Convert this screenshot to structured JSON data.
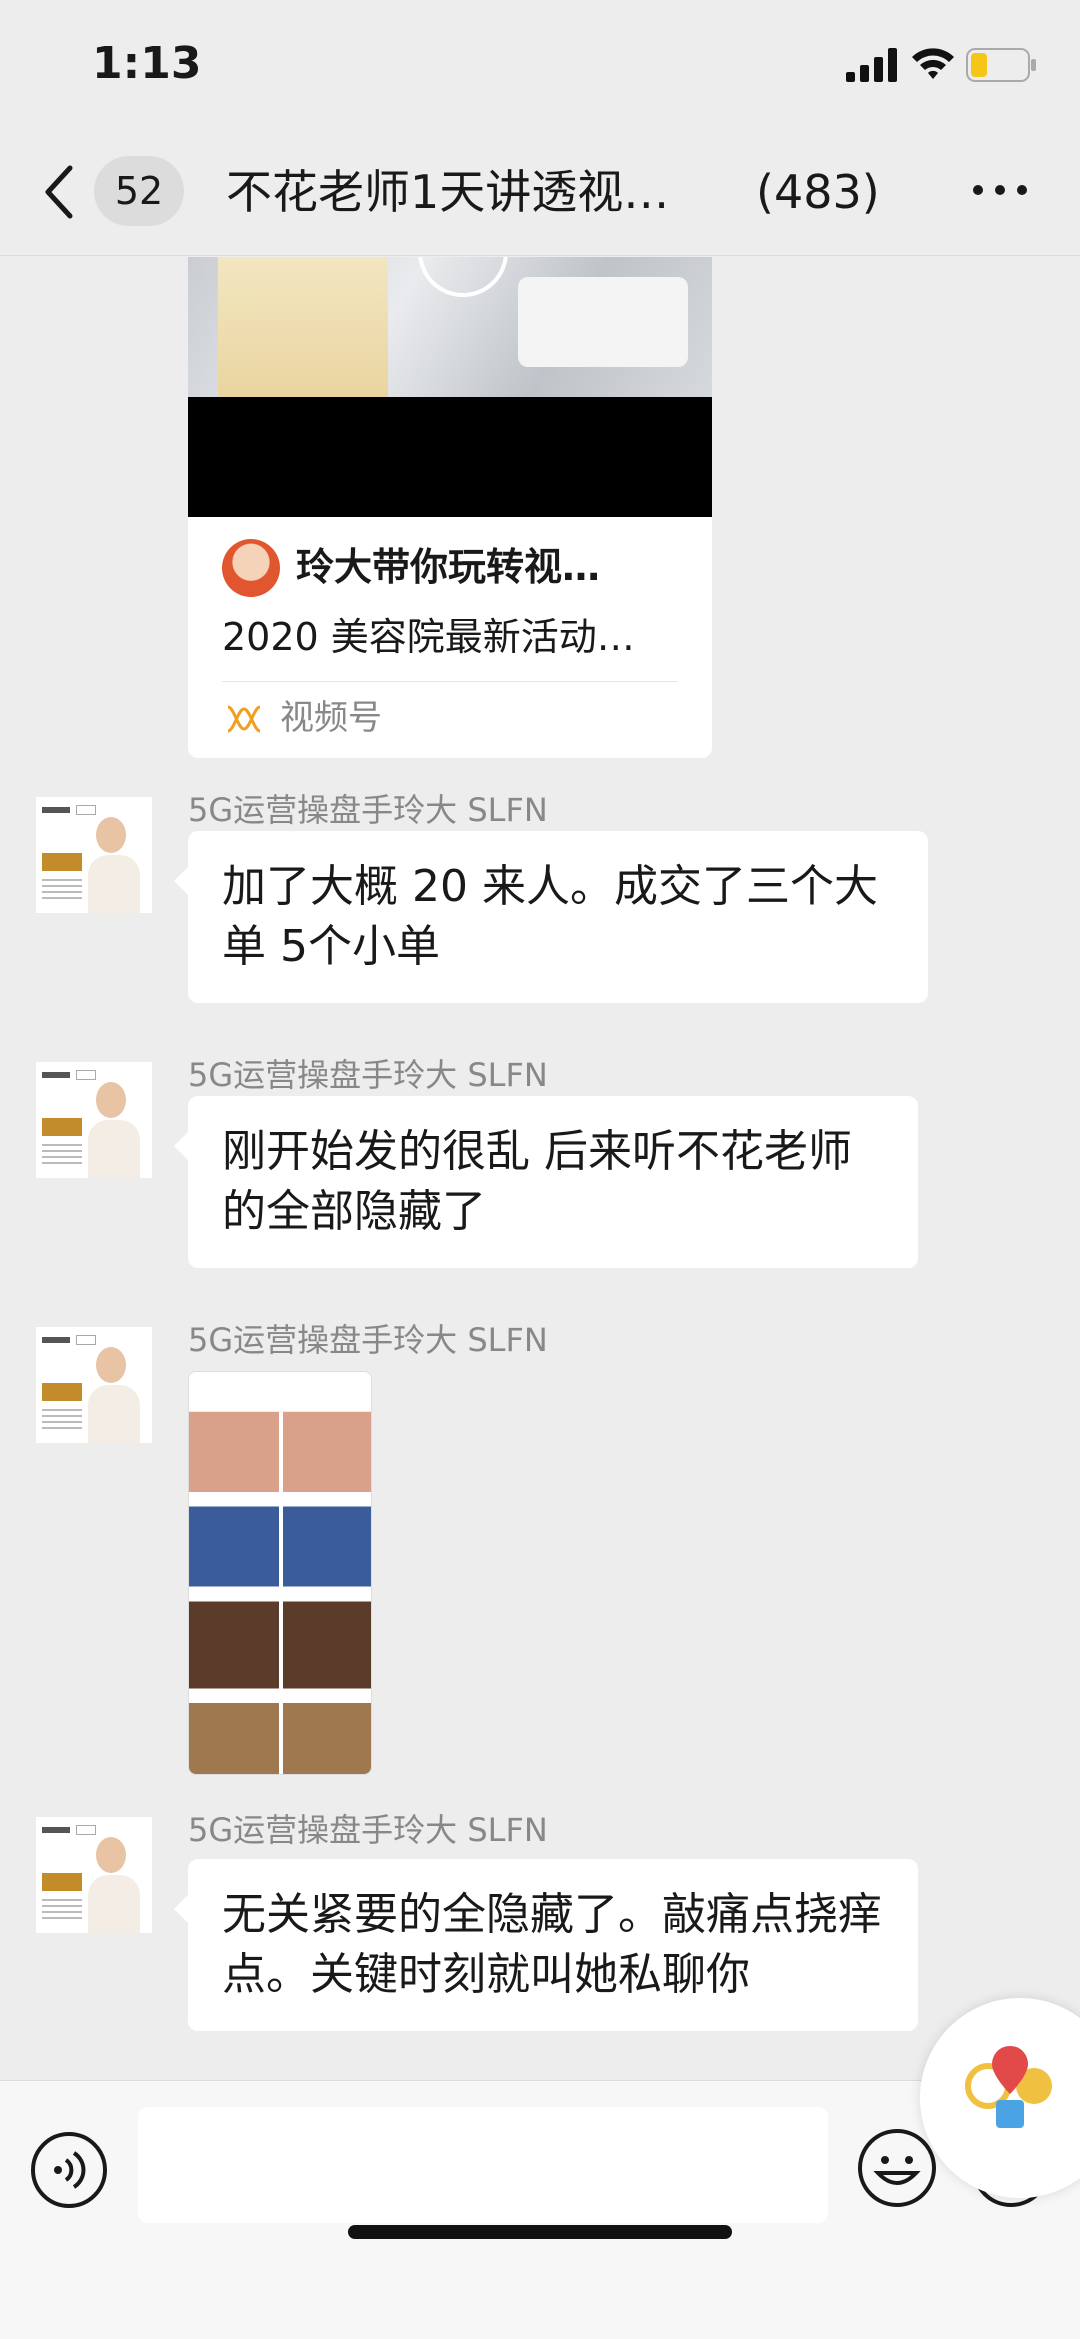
{
  "status_bar": {
    "time": "1:13",
    "battery_color": "#f5c518"
  },
  "nav": {
    "unread_count": "52",
    "title": "不花老师1天讲透视…",
    "member_count": "(483)"
  },
  "video_card": {
    "author": "玲大带你玩转视…",
    "description": "2020 美容院最新活动…",
    "source": "视频号"
  },
  "messages": [
    {
      "sender": "5G运营操盘手玲大 SLFN",
      "type": "text",
      "text": "加了大概 20 来人。成交了三个大单 5个小单"
    },
    {
      "sender": "5G运营操盘手玲大 SLFN",
      "type": "text",
      "text": "刚开始发的很乱 后来听不花老师的全部隐藏了"
    },
    {
      "sender": "5G运营操盘手玲大 SLFN",
      "type": "image"
    },
    {
      "sender": "5G运营操盘手玲大 SLFN",
      "type": "text",
      "text": "无关紧要的全隐藏了。敲痛点挠痒点。关键时刻就叫她私聊你"
    }
  ],
  "input": {
    "placeholder": ""
  },
  "colors": {
    "background": "#ededed",
    "bubble": "#ffffff",
    "secondary_text": "#888888"
  }
}
